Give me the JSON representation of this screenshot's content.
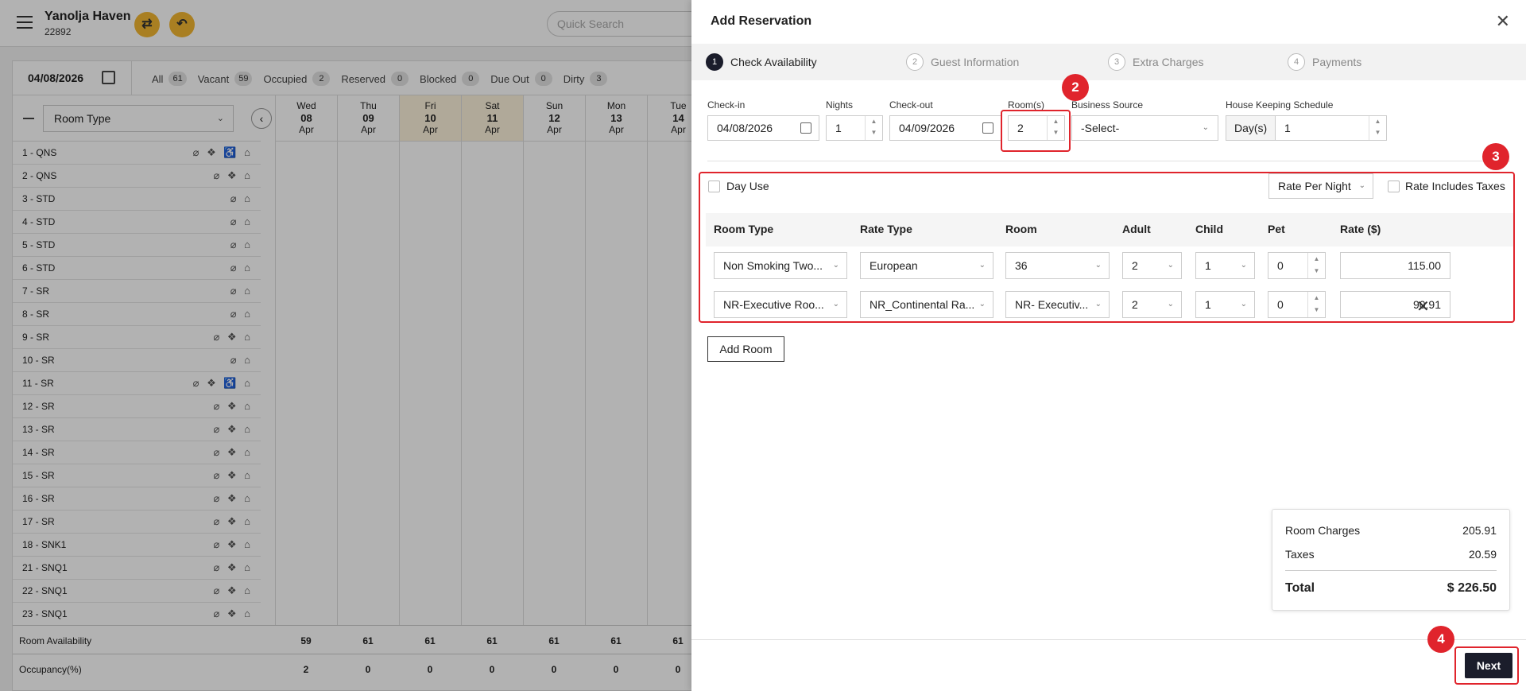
{
  "header": {
    "hotel_name": "Yanolja Haven",
    "hotel_id": "22892",
    "search_placeholder": "Quick Search"
  },
  "filterbar": {
    "date": "04/08/2026",
    "filters": [
      {
        "label": "All",
        "count": "61"
      },
      {
        "label": "Vacant",
        "count": "59"
      },
      {
        "label": "Occupied",
        "count": "2"
      },
      {
        "label": "Reserved",
        "count": "0"
      },
      {
        "label": "Blocked",
        "count": "0"
      },
      {
        "label": "Due Out",
        "count": "0"
      },
      {
        "label": "Dirty",
        "count": "3"
      }
    ]
  },
  "grid": {
    "room_type_select": "Room Type",
    "days": [
      {
        "dow": "Wed",
        "day": "08",
        "mon": "Apr",
        "weekend": false
      },
      {
        "dow": "Thu",
        "day": "09",
        "mon": "Apr",
        "weekend": false
      },
      {
        "dow": "Fri",
        "day": "10",
        "mon": "Apr",
        "weekend": true
      },
      {
        "dow": "Sat",
        "day": "11",
        "mon": "Apr",
        "weekend": true
      },
      {
        "dow": "Sun",
        "day": "12",
        "mon": "Apr",
        "weekend": false
      },
      {
        "dow": "Mon",
        "day": "13",
        "mon": "Apr",
        "weekend": false
      },
      {
        "dow": "Tue",
        "day": "14",
        "mon": "Apr",
        "weekend": false
      }
    ],
    "rooms": [
      {
        "name": "1 - QNS",
        "icons": "⌀ ❖ ♿ ⌂"
      },
      {
        "name": "2 - QNS",
        "icons": "⌀ ❖ ⌂"
      },
      {
        "name": "3 - STD",
        "icons": "⌀ ⌂"
      },
      {
        "name": "4 - STD",
        "icons": "⌀ ⌂"
      },
      {
        "name": "5 - STD",
        "icons": "⌀ ⌂"
      },
      {
        "name": "6 - STD",
        "icons": "⌀ ⌂"
      },
      {
        "name": "7 - SR",
        "icons": "⌀ ⌂"
      },
      {
        "name": "8 - SR",
        "icons": "⌀ ⌂"
      },
      {
        "name": "9 - SR",
        "icons": "⌀ ❖ ⌂"
      },
      {
        "name": "10 - SR",
        "icons": "⌀ ⌂"
      },
      {
        "name": "11 - SR",
        "icons": "⌀ ❖ ♿ ⌂"
      },
      {
        "name": "12 - SR",
        "icons": "⌀ ❖ ⌂"
      },
      {
        "name": "13 - SR",
        "icons": "⌀ ❖ ⌂"
      },
      {
        "name": "14 - SR",
        "icons": "⌀ ❖ ⌂"
      },
      {
        "name": "15 - SR",
        "icons": "⌀ ❖ ⌂"
      },
      {
        "name": "16 - SR",
        "icons": "⌀ ❖ ⌂"
      },
      {
        "name": "17 - SR",
        "icons": "⌀ ❖ ⌂"
      },
      {
        "name": "18 - SNK1",
        "icons": "⌀ ❖ ⌂"
      },
      {
        "name": "21 - SNQ1",
        "icons": "⌀ ❖ ⌂"
      },
      {
        "name": "22 - SNQ1",
        "icons": "⌀ ❖ ⌂"
      },
      {
        "name": "23 - SNQ1",
        "icons": "⌀ ❖ ⌂"
      }
    ],
    "availability_label": "Room Availability",
    "availability": [
      "59",
      "61",
      "61",
      "61",
      "61",
      "61",
      "61"
    ],
    "occupancy_label": "Occupancy(%)",
    "occupancy": [
      "2",
      "0",
      "0",
      "0",
      "0",
      "0",
      "0"
    ]
  },
  "drawer": {
    "title": "Add Reservation",
    "steps": [
      {
        "num": "1",
        "label": "Check Availability"
      },
      {
        "num": "2",
        "label": "Guest Information"
      },
      {
        "num": "3",
        "label": "Extra Charges"
      },
      {
        "num": "4",
        "label": "Payments"
      }
    ],
    "form": {
      "checkin_label": "Check-in",
      "checkin_value": "04/08/2026",
      "nights_label": "Nights",
      "nights_value": "1",
      "checkout_label": "Check-out",
      "checkout_value": "04/09/2026",
      "rooms_label": "Room(s)",
      "rooms_value": "2",
      "source_label": "Business Source",
      "source_value": "-Select-",
      "hk_label": "House Keeping Schedule",
      "hk_addon": "Day(s)",
      "hk_value": "1"
    },
    "day_use_label": "Day Use",
    "rate_mode": "Rate Per Night",
    "rate_includes_taxes_label": "Rate Includes Taxes",
    "table": {
      "headers": [
        "Room Type",
        "Rate Type",
        "Room",
        "Adult",
        "Child",
        "Pet",
        "Rate ($)"
      ],
      "rows": [
        {
          "room_type": "Non Smoking Two...",
          "rate_type": "European",
          "room": "36",
          "adult": "2",
          "child": "1",
          "pet": "0",
          "rate": "115.00"
        },
        {
          "room_type": "NR-Executive Roo...",
          "rate_type": "NR_Continental Ra...",
          "room": "NR- Executiv...",
          "adult": "2",
          "child": "1",
          "pet": "0",
          "rate": "90.91"
        }
      ]
    },
    "add_room_label": "Add Room",
    "summary": {
      "room_charges_label": "Room Charges",
      "room_charges": "205.91",
      "taxes_label": "Taxes",
      "taxes": "20.59",
      "total_label": "Total",
      "total": "$ 226.50"
    },
    "next_label": "Next"
  },
  "annotations": [
    "2",
    "3",
    "4"
  ],
  "colors": {
    "accent": "#1b1d2b",
    "annotation": "#e0242c",
    "brand_button": "#f2b632"
  }
}
